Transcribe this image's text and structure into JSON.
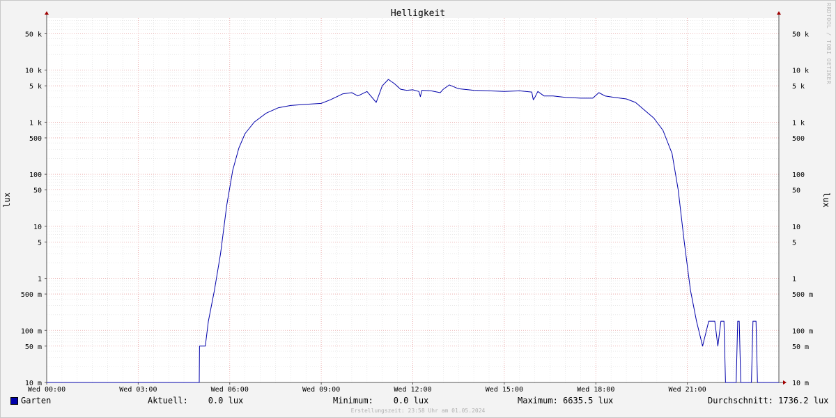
{
  "chart_data": {
    "type": "line",
    "title": "Helligkeit",
    "ylabel": "lux",
    "yscale": "log",
    "ylim": [
      0.01,
      100000
    ],
    "xlim": [
      0,
      24
    ],
    "x_tick_hours": [
      0,
      3,
      6,
      9,
      12,
      15,
      18,
      21
    ],
    "x_tick_labels": [
      "Wed 00:00",
      "Wed 03:00",
      "Wed 06:00",
      "Wed 09:00",
      "Wed 12:00",
      "Wed 15:00",
      "Wed 18:00",
      "Wed 21:00"
    ],
    "y_ticks": [
      0.01,
      0.05,
      0.1,
      0.5,
      1,
      5,
      10,
      50,
      100,
      500,
      1000,
      5000,
      10000,
      50000
    ],
    "y_tick_labels": [
      "10 m",
      "50 m",
      "100 m",
      "500 m",
      "1",
      "5",
      "10",
      "50",
      "100",
      "500",
      "1 k",
      "5 k",
      "10 k",
      "50 k"
    ],
    "grid": true,
    "series": [
      {
        "name": "Garten",
        "color": "#0000aa",
        "x": [
          0,
          5.0,
          5.01,
          5.2,
          5.3,
          5.5,
          5.7,
          5.9,
          6.1,
          6.3,
          6.5,
          6.8,
          7.2,
          7.6,
          8.0,
          8.5,
          9.0,
          9.3,
          9.7,
          10.0,
          10.2,
          10.5,
          10.8,
          11.0,
          11.2,
          11.4,
          11.6,
          11.8,
          12.0,
          12.2,
          12.25,
          12.3,
          12.6,
          12.9,
          13.0,
          13.2,
          13.5,
          14.0,
          14.5,
          15.0,
          15.5,
          15.9,
          15.95,
          16.0,
          16.1,
          16.3,
          16.6,
          17.0,
          17.5,
          17.9,
          18.1,
          18.3,
          18.6,
          19.0,
          19.3,
          19.6,
          19.9,
          20.2,
          20.5,
          20.7,
          20.9,
          21.1,
          21.3,
          21.5,
          21.7,
          21.9,
          22.0,
          22.1,
          22.2,
          22.25,
          22.3,
          22.35,
          22.4,
          22.5,
          22.6,
          22.65,
          22.7,
          22.75,
          22.8,
          23.0,
          23.1,
          23.15,
          23.25,
          23.3,
          24.0
        ],
        "y": [
          0.01,
          0.01,
          0.05,
          0.05,
          0.15,
          0.6,
          3,
          25,
          120,
          320,
          600,
          1000,
          1500,
          1900,
          2100,
          2200,
          2300,
          2700,
          3500,
          3700,
          3200,
          3900,
          2400,
          5000,
          6635.5,
          5500,
          4300,
          4100,
          4200,
          3900,
          3100,
          4100,
          4000,
          3700,
          4300,
          5200,
          4400,
          4100,
          4000,
          3900,
          4000,
          3800,
          2700,
          3000,
          3900,
          3200,
          3200,
          3000,
          2900,
          2900,
          3700,
          3200,
          3000,
          2800,
          2400,
          1700,
          1200,
          700,
          250,
          50,
          5,
          0.6,
          0.15,
          0.05,
          0.15,
          0.15,
          0.05,
          0.15,
          0.15,
          0.01,
          0.01,
          0.01,
          0.01,
          0.01,
          0.01,
          0.15,
          0.15,
          0.01,
          0.01,
          0.01,
          0.01,
          0.15,
          0.15,
          0.01,
          0.01
        ]
      }
    ]
  },
  "legend": {
    "series_name": "Garten",
    "aktuell": "Aktuell:    0.0 lux",
    "minimum": "Minimum:    0.0 lux",
    "maximum": "Maximum: 6635.5 lux",
    "durchschnitt": "Durchschnitt: 1736.2 lux"
  },
  "footer": "Erstellungszeit: 23:58 Uhr am 01.05.2024",
  "watermark": "RRDTOOL / TOBI OETIKER"
}
